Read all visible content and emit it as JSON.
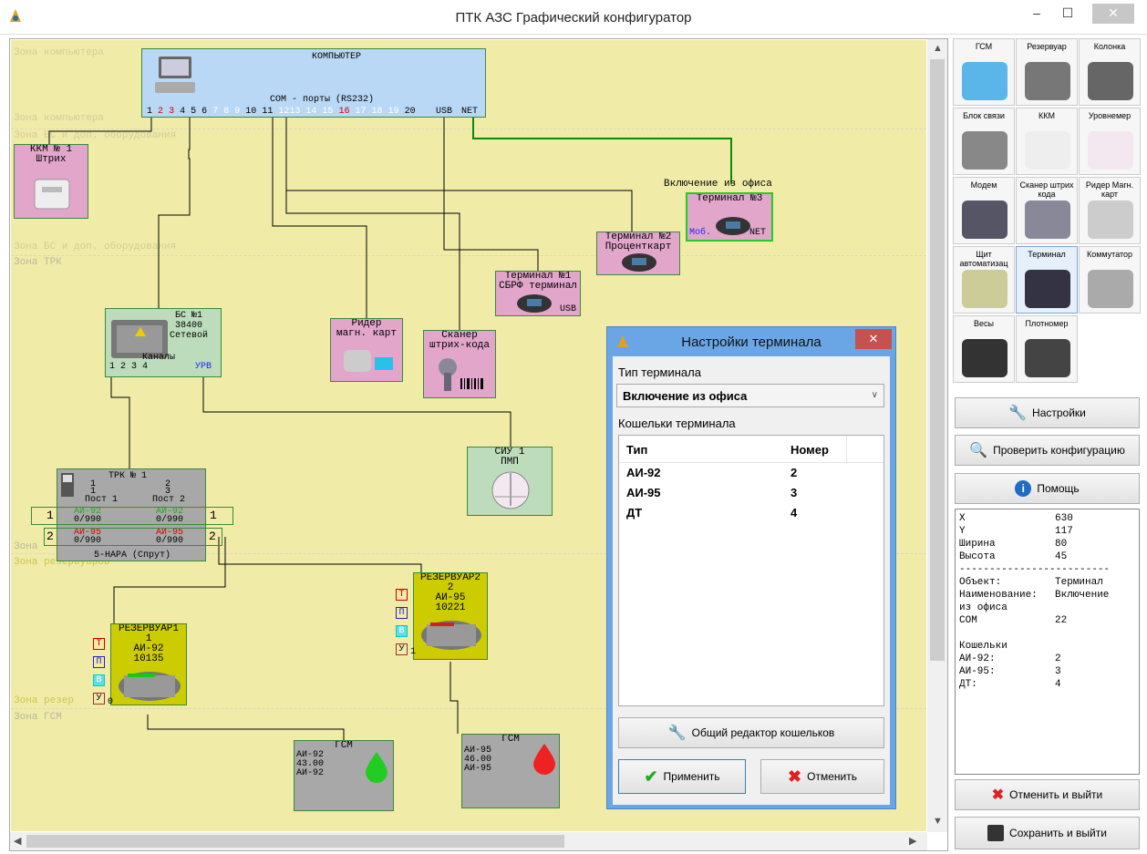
{
  "window": {
    "title": "ПТК АЗС Графический конфигуратор",
    "min": "–",
    "max": "☐",
    "close": "✕"
  },
  "zones": {
    "computer_top": "Зона компьютера",
    "computer_bottom": "Зона компьютера",
    "bs_top": "Зона БС и доп. оборудования",
    "bs_bottom": "Зона БС и доп. оборудования",
    "trk": "Зона ТРК",
    "res_top": "Зона резервуаров",
    "res_bottom": "Зона резер",
    "gsm": "Зона ГСМ",
    "trk_tail": "Зона"
  },
  "computer": {
    "title": "КОМПЬЮТЕР",
    "ports_label": "COM - порты (RS232)",
    "ports": [
      "1",
      "2",
      "3",
      "4",
      "5",
      "6",
      "7",
      "8",
      "9",
      "10",
      "11",
      "12",
      "13",
      "14",
      "15",
      "16",
      "17",
      "18",
      "19",
      "20"
    ],
    "usb": "USB",
    "net": "NET"
  },
  "kkm": {
    "title": "ККМ № 1",
    "sub": "Штрих"
  },
  "term3": {
    "title": "Терминал №3",
    "sub": "Включение из офиса",
    "mob": "Моб.",
    "net": "NET"
  },
  "term2": {
    "title": "Терминал №2",
    "sub": "Проценткарт"
  },
  "term1": {
    "title": "Терминал №1",
    "sub": "СБРФ терминал",
    "usb": "USB"
  },
  "bs": {
    "title": "БС №1",
    "speed": "38400",
    "type": "Сетевой",
    "channels": "Каналы",
    "nums": "1 2 3 4",
    "urv": "УРВ"
  },
  "reader": {
    "title": "Ридер",
    "sub": "магн. карт"
  },
  "scanner": {
    "title": "Сканер",
    "sub": "штрих-кода"
  },
  "siu": {
    "title": "СИУ 1",
    "sub": "ПМП"
  },
  "trk": {
    "title": "ТРК № 1",
    "p1": "1",
    "p1b": "1",
    "p2": "2",
    "p2b": "3",
    "post1": "Пост 1",
    "post2": "Пост 2",
    "g1": "АИ-92",
    "g2": "АИ-92",
    "v1": "0/990",
    "v2": "0/990",
    "g3": "АИ-95",
    "g4": "АИ-95",
    "v3": "0/990",
    "v4": "0/990",
    "n1": "1",
    "n2": "2",
    "n3": "1",
    "n4": "2",
    "model": "5-НАРА (Спрут)"
  },
  "res1": {
    "title": "РЕЗЕРВУАР1",
    "num": "1",
    "fuel": "АИ-92",
    "vol": "10135",
    "t": "Т",
    "p": "П",
    "v": "В",
    "u": "У",
    "n": "0"
  },
  "res2": {
    "title": "РЕЗЕРВУАР2",
    "num": "2",
    "fuel": "АИ-95",
    "vol": "10221",
    "t": "Т",
    "p": "П",
    "v": "В",
    "u": "У",
    "n": "1"
  },
  "gsm1": {
    "title": "ГСМ",
    "l1": "АИ-92",
    "l2": "43.00",
    "l3": "АИ-92"
  },
  "gsm2": {
    "title": "ГСМ",
    "l1": "АИ-95",
    "l2": "46.00",
    "l3": "АИ-95"
  },
  "dialog": {
    "title": "Настройки терминала",
    "close": "✕",
    "type_label": "Тип терминала",
    "type_value": "Включение из офиса",
    "wallets_label": "Кошельки терминала",
    "col_type": "Тип",
    "col_num": "Номер",
    "rows": [
      [
        "АИ-92",
        "2"
      ],
      [
        "АИ-95",
        "3"
      ],
      [
        "ДТ",
        "4"
      ]
    ],
    "editor_btn": "Общий редактор кошельков",
    "apply_btn": "Применить",
    "cancel_btn": "Отменить"
  },
  "tools": [
    {
      "label": "ГСМ",
      "icon": "fuel-drop-icon"
    },
    {
      "label": "Резервуар",
      "icon": "tank-icon"
    },
    {
      "label": "Колонка",
      "icon": "pump-icon"
    },
    {
      "label": "Блок связи",
      "icon": "comm-block-icon"
    },
    {
      "label": "ККМ",
      "icon": "cash-register-icon"
    },
    {
      "label": "Уровнемер",
      "icon": "level-gauge-icon"
    },
    {
      "label": "Модем",
      "icon": "modem-icon"
    },
    {
      "label": "Сканер штрих кода",
      "icon": "barcode-scanner-icon"
    },
    {
      "label": "Ридер Магн. карт",
      "icon": "card-reader-icon"
    },
    {
      "label": "Щит автоматизац",
      "icon": "panel-icon"
    },
    {
      "label": "Терминал",
      "icon": "terminal-icon"
    },
    {
      "label": "Коммутатор",
      "icon": "switch-icon"
    },
    {
      "label": "Весы",
      "icon": "scales-icon"
    },
    {
      "label": "Плотномер",
      "icon": "densimeter-icon"
    }
  ],
  "buttons": {
    "settings": "Настройки",
    "check": "Проверить конфигурацию",
    "help": "Помощь",
    "cancel_exit": "Отменить и выйти",
    "save_exit": "Сохранить и выйти"
  },
  "info": {
    "rows": [
      [
        "X",
        "630"
      ],
      [
        "Y",
        "117"
      ],
      [
        "Ширина",
        "80"
      ],
      [
        "Высота",
        "45"
      ]
    ],
    "sep": "-------------------------",
    "obj_k": "Объект:",
    "obj_v": "Терминал",
    "name_k": "Наименование:",
    "name_v": "Включение",
    "name_cont": "из офиса",
    "com_k": "COM",
    "com_v": "22",
    "wallets": "Кошельки",
    "w": [
      [
        "АИ-92:",
        "2"
      ],
      [
        "АИ-95:",
        "3"
      ],
      [
        "ДТ:",
        "4"
      ]
    ]
  },
  "colors": {
    "canvas": "#f1eba8",
    "pink": "#e2a6cb",
    "blue": "#b8d8f5",
    "yellow": "#cccc00",
    "wire": "#000000",
    "net_wire": "#0a8a0a"
  }
}
